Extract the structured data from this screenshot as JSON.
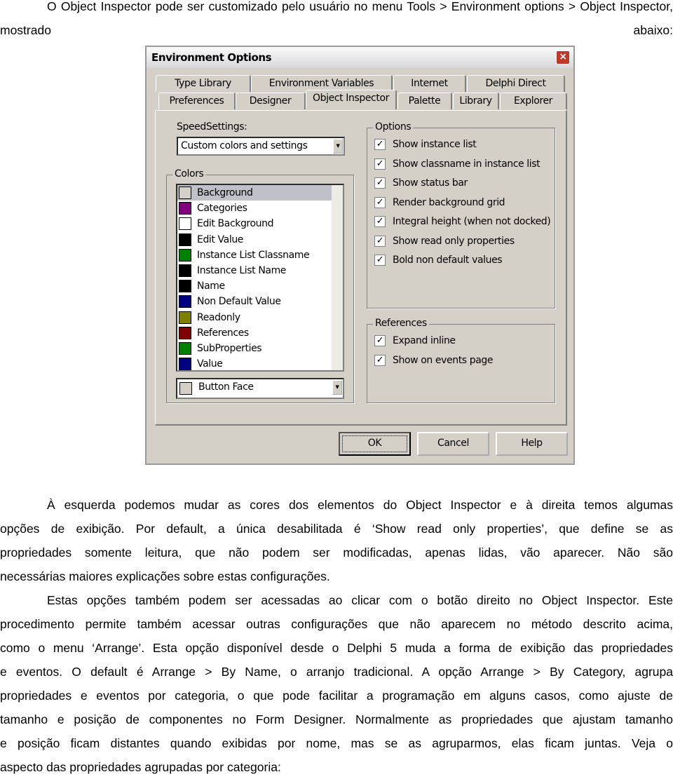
{
  "intro": "O Object Inspector pode ser customizado pelo usuário no menu Tools > Environment options > Object Inspector, mostrado abaixo:",
  "dialog": {
    "title": "Environment Options",
    "close_icon": "close-icon",
    "tabs_row1": [
      "Type Library",
      "Environment Variables",
      "Internet",
      "Delphi Direct"
    ],
    "tabs_row2": [
      "Preferences",
      "Designer",
      "Object Inspector",
      "Palette",
      "Library",
      "Explorer"
    ],
    "selected_tab": "Object Inspector",
    "speed_label": "SpeedSettings:",
    "speed_value": "Custom colors and settings",
    "colors_label": "Colors",
    "colors": [
      {
        "name": "Background",
        "color": "#d4d0c8"
      },
      {
        "name": "Categories",
        "color": "#800080"
      },
      {
        "name": "Edit Background",
        "color": "#ffffff"
      },
      {
        "name": "Edit Value",
        "color": "#000000"
      },
      {
        "name": "Instance List Classname",
        "color": "#008000"
      },
      {
        "name": "Instance List Name",
        "color": "#000000"
      },
      {
        "name": "Name",
        "color": "#000000"
      },
      {
        "name": "Non Default Value",
        "color": "#000080"
      },
      {
        "name": "Readonly",
        "color": "#808000"
      },
      {
        "name": "References",
        "color": "#800000"
      },
      {
        "name": "SubProperties",
        "color": "#008000"
      },
      {
        "name": "Value",
        "color": "#000080"
      }
    ],
    "color_value": "Button Face",
    "options_label": "Options",
    "options": [
      {
        "label": "Show instance list",
        "checked": true
      },
      {
        "label": "Show classname in instance list",
        "checked": true
      },
      {
        "label": "Show status bar",
        "checked": true
      },
      {
        "label": "Render background grid",
        "checked": true
      },
      {
        "label": "Integral height (when not docked)",
        "checked": true
      },
      {
        "label": "Show read only properties",
        "checked": true
      },
      {
        "label": "Bold non default values",
        "checked": true
      }
    ],
    "references_label": "References",
    "references": [
      {
        "label": "Expand inline",
        "checked": true
      },
      {
        "label": "Show on events page",
        "checked": true
      }
    ],
    "buttons": {
      "ok": "OK",
      "cancel": "Cancel",
      "help": "Help"
    }
  },
  "paragraphs": [
    [
      "À esquerda podemos mudar as cores dos elementos do Object Inspector e à direita temos algumas",
      "opções de exibição. Por default, a única desabilitada é ‘Show read only properties’, que define se as",
      "propriedades somente leitura, que não podem ser modificadas, apenas lidas, vão aparecer. Não são",
      "necessárias maiores explicações sobre estas configurações."
    ],
    [
      "Estas opções também podem ser acessadas ao clicar com o botão direito no Object Inspector. Este",
      "procedimento permite também acessar outras configurações que não aparecem no método descrito acima,",
      "como o menu ‘Arrange’. Esta opção disponível desde o Delphi 5 muda a forma de exibição das propriedades",
      "e eventos. O default é Arrange > By Name, o arranjo tradicional. A opção Arrange > By Category, agrupa",
      "propriedades e eventos por categoria, o que pode facilitar a programação em alguns casos, como ajuste de",
      "tamanho e posição de componentes no Form Designer. Normalmente as propriedades que ajustam tamanho",
      "e posição ficam distantes quando exibidas por nome, mas se as agruparmos, elas ficam juntas. Veja o",
      "aspecto das propriedades agrupadas por categoria:"
    ]
  ]
}
